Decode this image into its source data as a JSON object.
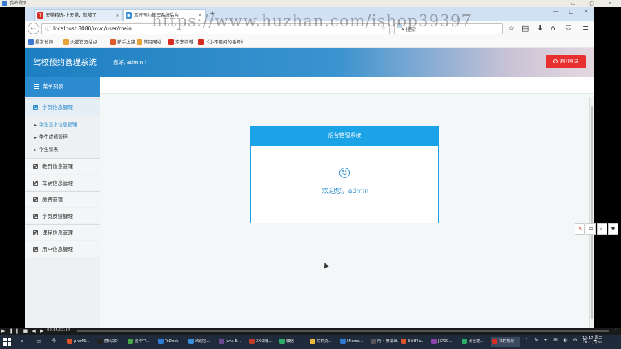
{
  "player": {
    "title": "我的视频",
    "controls": "▭ ▢ ✕"
  },
  "watermark": "https://www.huzhan.com/ishop39397",
  "browser": {
    "tabs": [
      {
        "label": "天猫精选-上天猫，就够了",
        "close": "×",
        "icon": "T"
      },
      {
        "label": "驾校预约管理系统后台",
        "close": "×",
        "icon": "◉"
      }
    ],
    "new_tab": "+",
    "window_buttons": "— ▢ ✕",
    "back": "←",
    "info_icon": "ⓘ",
    "url": "localhost:8080/mvc/user/main",
    "reader_icon": "☆",
    "search_icon": "🔍",
    "search_placeholder": "搜索",
    "toolbar_icons": {
      "bookmark_star": "☆",
      "library": "▤",
      "download": "⬇",
      "home": "⌂",
      "pocket": "⛉",
      "menu": "≡"
    },
    "bookmarks": [
      {
        "label": "最常访问",
        "color": "#3b7bd5"
      },
      {
        "label": "火狐官方站点",
        "color": "#e8a23a"
      },
      {
        "label": "新手上路",
        "color": "#e25b2a"
      },
      {
        "label": "常用网址",
        "color": "#e8a23a"
      },
      {
        "label": "京东商城",
        "color": "#d62d20"
      },
      {
        "label": "《小不要问的番号》...",
        "color": "#d62d20"
      }
    ]
  },
  "app": {
    "title": "驾校预约管理系统",
    "greeting": "您好, admin !",
    "logout_label": "退出登录",
    "menu_header": "菜单列表",
    "menu": [
      {
        "label": "学员信息管理",
        "active": true
      },
      {
        "label": "教员信息管理"
      },
      {
        "label": "车辆信息管理"
      },
      {
        "label": "缴费管理"
      },
      {
        "label": "学员反馈管理"
      },
      {
        "label": "课程信息管理"
      },
      {
        "label": "用户信息管理"
      }
    ],
    "submenu": [
      "学生基本信息管理",
      "学生成绩管理",
      "学生课表"
    ],
    "card_title": "后台管理系统",
    "welcome": "欢迎您，admin"
  },
  "ime": [
    "S",
    "中",
    "☾",
    "♥"
  ],
  "video_bar": {
    "controls": "▶ ❚❚ ■ ◀ ▶",
    "time": "00:15/02:14",
    "progress": 0.0,
    "fullscreen": "⛶"
  },
  "taskbar": {
    "tools": [
      "⌕",
      "▭",
      "⚘"
    ],
    "apps": [
      {
        "label": "php46...",
        "color": "#d9542c"
      },
      {
        "label": "腾讯QQ",
        "color": "#222"
      },
      {
        "label": "创作中...",
        "color": "#48a848"
      },
      {
        "label": "ToDesk",
        "color": "#2d7cd8"
      },
      {
        "label": "欢迎您...",
        "color": "#3b8fd9"
      },
      {
        "label": "Java E...",
        "color": "#6a4a8f"
      },
      {
        "label": "XX课像...",
        "color": "#c0392b"
      },
      {
        "label": "微信",
        "color": "#2aae67"
      },
      {
        "label": "文件资...",
        "color": "#e8b93a"
      },
      {
        "label": "Micros...",
        "color": "#2b7bd5"
      },
      {
        "label": "阿 • 屏幕录...",
        "color": "#555"
      },
      {
        "label": "EditPlu...",
        "color": "#d9542c"
      },
      {
        "label": "JSP20...",
        "color": "#8e44ad"
      },
      {
        "label": "安全提...",
        "color": "#2aae67"
      },
      {
        "label": "我的视频",
        "color": "#d62d20"
      }
    ],
    "tray": "⌃ ✎ ✦ ⊞ ◐ ⊕ ✉ ☁",
    "time": "13:17 周二",
    "date": "2021/3/31"
  }
}
